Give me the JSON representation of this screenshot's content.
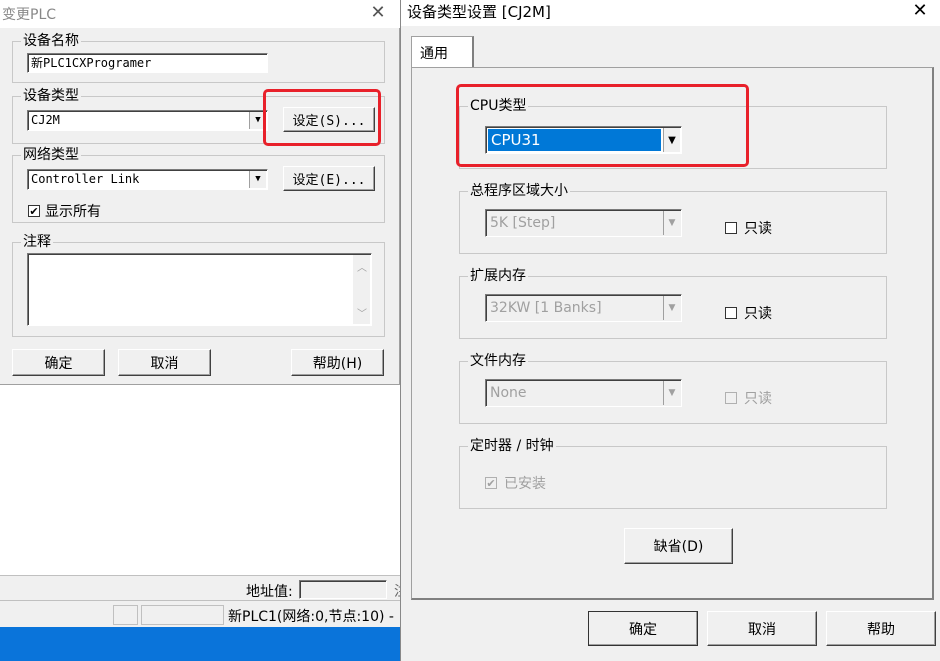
{
  "left_dialog": {
    "title": "变更PLC",
    "device_name_label": "设备名称",
    "device_name_value": "新PLC1CXProgramer",
    "device_type_label": "设备类型",
    "device_type_value": "CJ2M",
    "device_type_settings": "设定(S)...",
    "network_type_label": "网络类型",
    "network_type_value": "Controller Link",
    "network_type_settings": "设定(E)...",
    "show_all_label": "显示所有",
    "show_all_checked": true,
    "comment_label": "注释",
    "comment_value": "",
    "ok_button": "确定",
    "cancel_button": "取消",
    "help_button": "帮助(H)"
  },
  "background": {
    "address_label": "地址值:",
    "status_text": "新PLC1(网络:0,节点:10) -",
    "clipped_char": "注"
  },
  "right_dialog": {
    "title": "设备类型设置 [CJ2M]",
    "tab": "通用",
    "cpu_type_label": "CPU类型",
    "cpu_type_value": "CPU31",
    "program_area_label": "总程序区域大小",
    "program_area_value": "5K [Step]",
    "readonly_label_1": "只读",
    "ext_memory_label": "扩展内存",
    "ext_memory_value": "32KW [1 Banks]",
    "readonly_label_2": "只读",
    "file_memory_label": "文件内存",
    "file_memory_value": "None",
    "readonly_label_3": "只读",
    "timer_clock_label": "定时器 / 时钟",
    "installed_label": "已安装",
    "installed_checked": true,
    "default_button": "缺省(D)",
    "ok_button": "确定",
    "cancel_button": "取消",
    "help_button": "帮助"
  },
  "colors": {
    "dialog_bg": "#f0f0f0",
    "highlight": "#0078d7",
    "annotation_red": "#e8202a",
    "taskbar": "#0a74da"
  }
}
